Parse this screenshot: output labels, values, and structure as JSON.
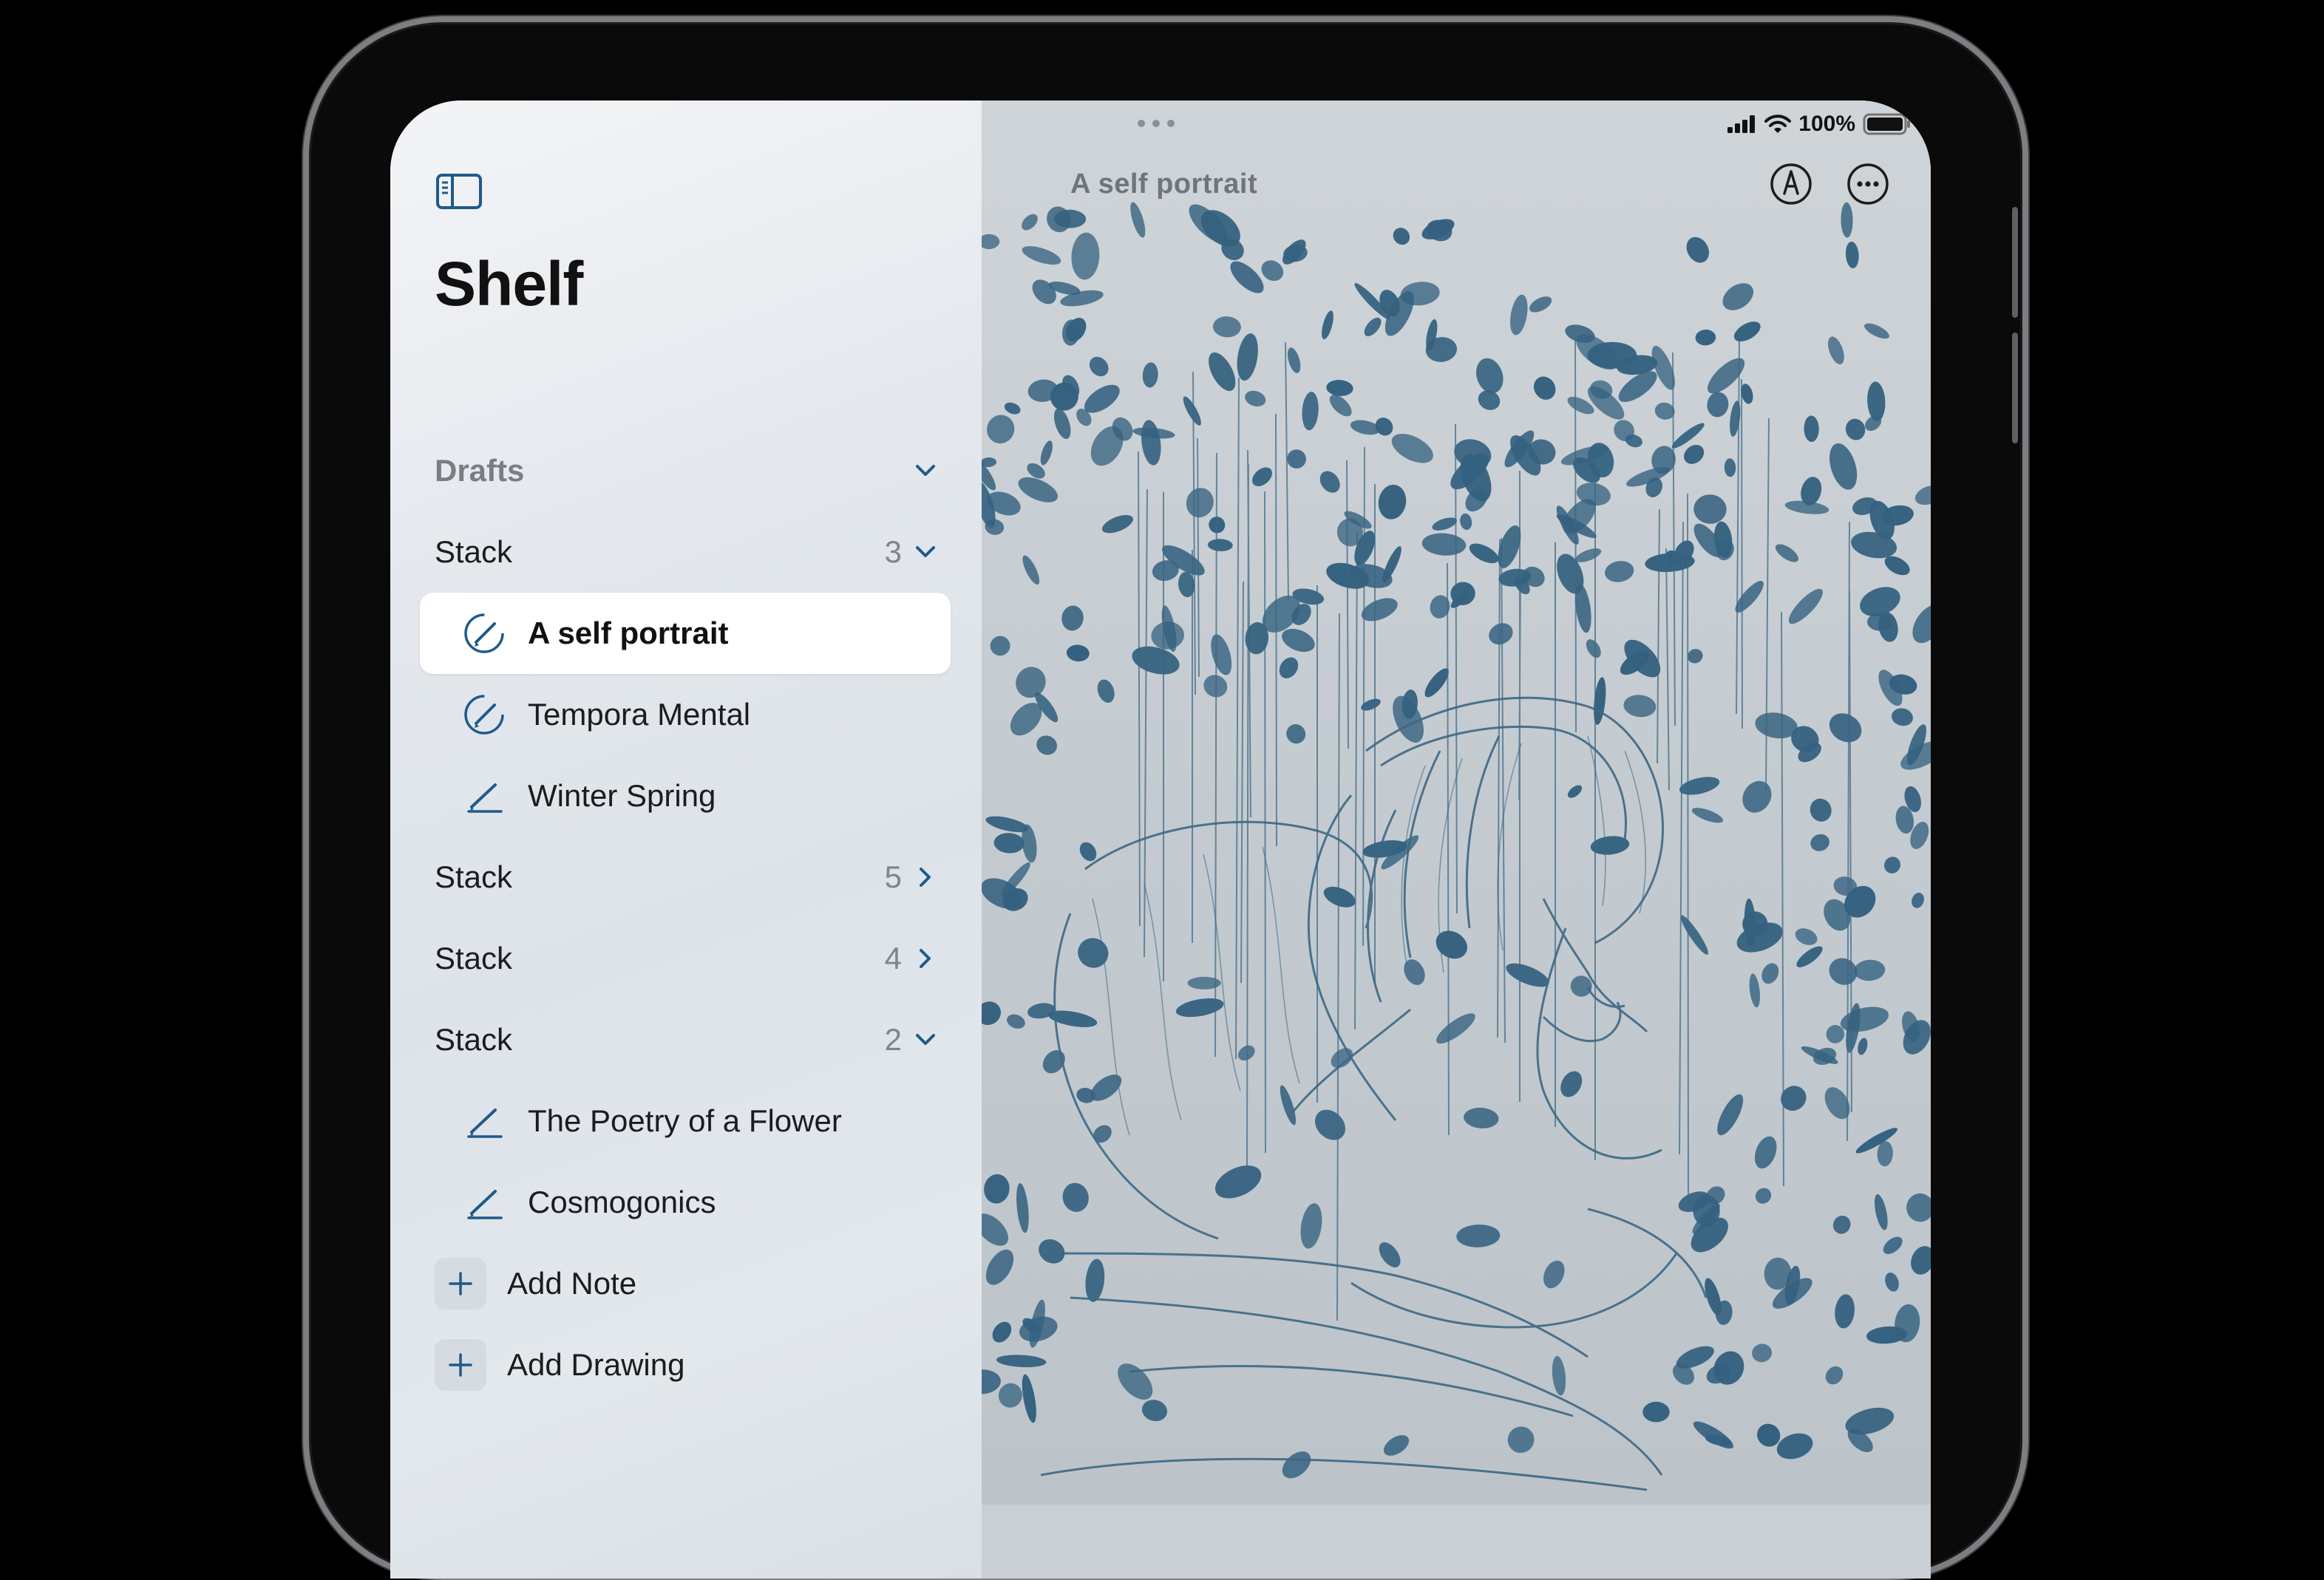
{
  "app": {
    "sidebar_title": "Shelf",
    "document_title": "A self portrait"
  },
  "status": {
    "battery_percent": "100%"
  },
  "sidebar": {
    "drafts_label": "Drafts",
    "stacks": [
      {
        "label": "Stack",
        "count": "3",
        "expanded": true,
        "items": [
          {
            "label": "A self portrait",
            "icon": "pencil-circle-icon",
            "selected": true
          },
          {
            "label": "Tempora Mental",
            "icon": "pencil-circle-icon",
            "selected": false
          },
          {
            "label": "Winter Spring",
            "icon": "pencil-icon",
            "selected": false
          }
        ]
      },
      {
        "label": "Stack",
        "count": "5",
        "expanded": false,
        "items": []
      },
      {
        "label": "Stack",
        "count": "4",
        "expanded": false,
        "items": []
      },
      {
        "label": "Stack",
        "count": "2",
        "expanded": true,
        "items": [
          {
            "label": "The Poetry of a Flower",
            "icon": "pencil-icon",
            "selected": false
          },
          {
            "label": "Cosmogonics",
            "icon": "pencil-icon",
            "selected": false
          }
        ]
      }
    ],
    "actions": [
      {
        "label": "Add Note",
        "icon": "plus-icon"
      },
      {
        "label": "Add Drawing",
        "icon": "plus-icon"
      }
    ]
  },
  "colors": {
    "accent": "#1f5a8a",
    "ink": "#2c5878",
    "paper": "#c9cfd4"
  }
}
